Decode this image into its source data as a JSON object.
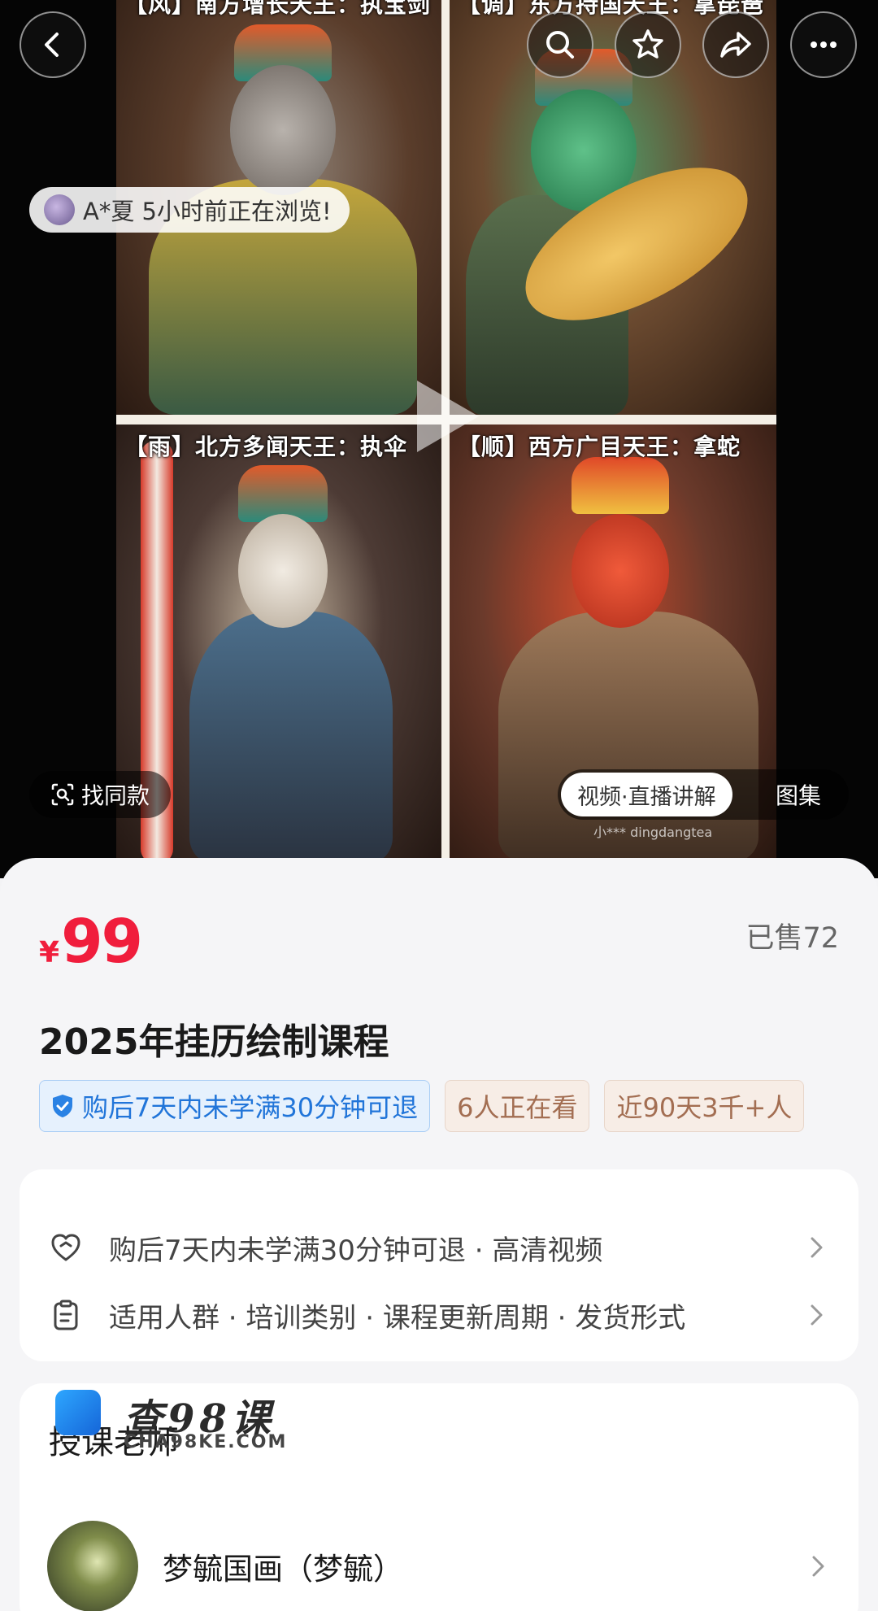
{
  "media": {
    "panels": [
      {
        "caption": "【风】南方增长天王：执宝剑"
      },
      {
        "caption": "【调】东方持国天王：拿琵琶"
      },
      {
        "caption": "【雨】北方多闻天王：执伞"
      },
      {
        "caption": "【顺】西方广目天王：拿蛇"
      }
    ],
    "watermark": "小*** dingdangtea",
    "viewer_notice": "A*夏 5小时前正在浏览!",
    "find_similar_label": "找同款",
    "tabs": {
      "active": "视频·直播讲解",
      "other": "图集"
    }
  },
  "top_bar": {
    "back_icon": "chevron-left-icon",
    "search_icon": "search-icon",
    "favorite_icon": "star-icon",
    "share_icon": "share-icon",
    "more_icon": "more-icon"
  },
  "product": {
    "currency": "¥",
    "price": "99",
    "sold": "已售72",
    "title": "2025年挂历绘制课程",
    "tags": [
      {
        "text": "购后7天内未学满30分钟可退",
        "style": "blue"
      },
      {
        "text": "6人正在看",
        "style": "beige"
      },
      {
        "text": "近90天3千+人",
        "style": "beige"
      }
    ]
  },
  "info": {
    "rows": [
      {
        "text": "购后7天内未学满30分钟可退 · 高清视频",
        "icon": "heart-refund-icon"
      },
      {
        "text": "适用人群 · 培训类别 · 课程更新周期 · 发货形式",
        "icon": "clipboard-icon"
      }
    ]
  },
  "teacher_section": {
    "title": "授课老师",
    "teacher_name": "梦毓国画（梦毓）",
    "brand_watermark": {
      "name": "查98课",
      "domain": "CHA98KE.COM"
    }
  },
  "colors": {
    "price": "#f01d3c",
    "tag_blue": "#2175d9",
    "tag_beige": "#a36e52"
  }
}
